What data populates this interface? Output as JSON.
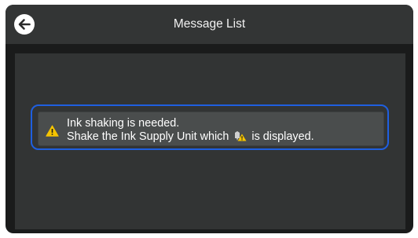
{
  "header": {
    "title": "Message List",
    "back_icon": "arrow-left-icon"
  },
  "messages": [
    {
      "icon": "warning-triangle-icon",
      "line1": "Ink shaking is needed.",
      "line2_before": "Shake the Ink Supply Unit which",
      "line2_icon": "ink-shake-warning-icon",
      "line2_after": "is displayed.",
      "selected": true
    }
  ],
  "colors": {
    "panel": "#1a1b1b",
    "header": "#333535",
    "list_bg": "#323434",
    "item_bg": "#4a4d4d",
    "selection": "#1f5fe0",
    "warning": "#f5c400"
  }
}
